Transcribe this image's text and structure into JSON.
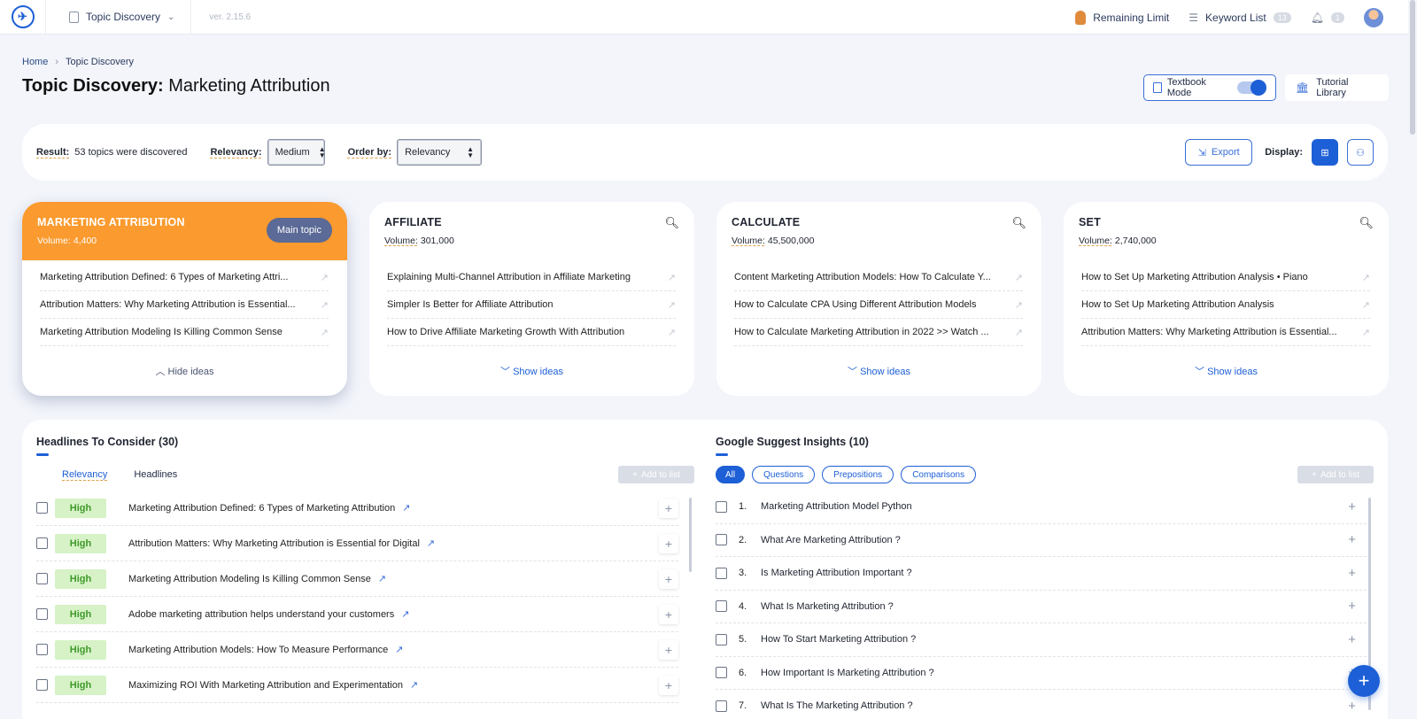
{
  "header": {
    "app_name": "Topic Discovery",
    "version": "ver. 2.15.6",
    "remaining_limit": "Remaining Limit",
    "keyword_list": "Keyword List",
    "keyword_count": "13",
    "notification_count": "1"
  },
  "breadcrumb": {
    "home": "Home",
    "current": "Topic Discovery"
  },
  "page": {
    "title_bold": "Topic Discovery:",
    "title_topic": "Marketing Attribution"
  },
  "actions": {
    "textbook_mode": "Textbook Mode",
    "tutorial_library": "Tutorial Library"
  },
  "filters": {
    "result_label": "Result:",
    "result_text": "53 topics were discovered",
    "relevancy_label": "Relevancy:",
    "relevancy_value": "Medium",
    "order_label": "Order by:",
    "order_value": "Relevancy",
    "export": "Export",
    "display_label": "Display:"
  },
  "cards": [
    {
      "title": "MARKETING ATTRIBUTION",
      "volume_label": "Volume:",
      "volume": "4,400",
      "badge": "Main topic",
      "ideas": [
        "Marketing Attribution Defined: 6 Types of Marketing Attri...",
        "Attribution Matters: Why Marketing Attribution is Essential...",
        "Marketing Attribution Modeling Is Killing Common Sense"
      ],
      "toggle": "Hide ideas"
    },
    {
      "title": "AFFILIATE",
      "volume_label": "Volume:",
      "volume": "301,000",
      "ideas": [
        "Explaining Multi-Channel Attribution in Affiliate Marketing",
        "Simpler Is Better for Affiliate Attribution",
        "How to Drive Affiliate Marketing Growth With Attribution"
      ],
      "toggle": "Show ideas"
    },
    {
      "title": "CALCULATE",
      "volume_label": "Volume:",
      "volume": "45,500,000",
      "ideas": [
        "Content Marketing Attribution Models: How To Calculate Y...",
        "How to Calculate CPA Using Different Attribution Models",
        "How to Calculate Marketing Attribution in 2022 >> Watch ..."
      ],
      "toggle": "Show ideas"
    },
    {
      "title": "SET",
      "volume_label": "Volume:",
      "volume": "2,740,000",
      "ideas": [
        "How to Set Up Marketing Attribution Analysis • Piano",
        "How to Set Up Marketing Attribution Analysis",
        "Attribution Matters: Why Marketing Attribution is Essential..."
      ],
      "toggle": "Show ideas"
    }
  ],
  "headlines": {
    "title": "Headlines To Consider (30)",
    "col_relevancy": "Relevancy",
    "col_headlines": "Headlines",
    "add_to_list": "Add to list",
    "rows": [
      {
        "relevancy": "High",
        "text": "Marketing Attribution Defined: 6 Types of Marketing Attribution"
      },
      {
        "relevancy": "High",
        "text": "Attribution Matters: Why Marketing Attribution is Essential for Digital"
      },
      {
        "relevancy": "High",
        "text": "Marketing Attribution Modeling Is Killing Common Sense"
      },
      {
        "relevancy": "High",
        "text": "Adobe marketing attribution helps understand your customers"
      },
      {
        "relevancy": "High",
        "text": "Marketing Attribution Models: How To Measure Performance"
      },
      {
        "relevancy": "High",
        "text": "Maximizing ROI With Marketing Attribution and Experimentation"
      }
    ]
  },
  "google_suggest": {
    "title": "Google Suggest Insights (10)",
    "chips": [
      "All",
      "Questions",
      "Prepositions",
      "Comparisons"
    ],
    "add_to_list": "Add to list",
    "rows": [
      {
        "num": "1.",
        "text": "Marketing Attribution Model Python"
      },
      {
        "num": "2.",
        "text": "What Are Marketing Attribution ?"
      },
      {
        "num": "3.",
        "text": "Is Marketing Attribution Important ?"
      },
      {
        "num": "4.",
        "text": "What Is Marketing Attribution ?"
      },
      {
        "num": "5.",
        "text": "How To Start Marketing Attribution ?"
      },
      {
        "num": "6.",
        "text": "How Important Is Marketing Attribution ?"
      },
      {
        "num": "7.",
        "text": "What Is The Marketing Attribution ?"
      }
    ]
  },
  "colors": {
    "accent": "#1d5fd6",
    "main_topic": "#fb9a2e",
    "high_badge_bg": "#d6f2c6",
    "high_badge_text": "#3f9a2a"
  }
}
